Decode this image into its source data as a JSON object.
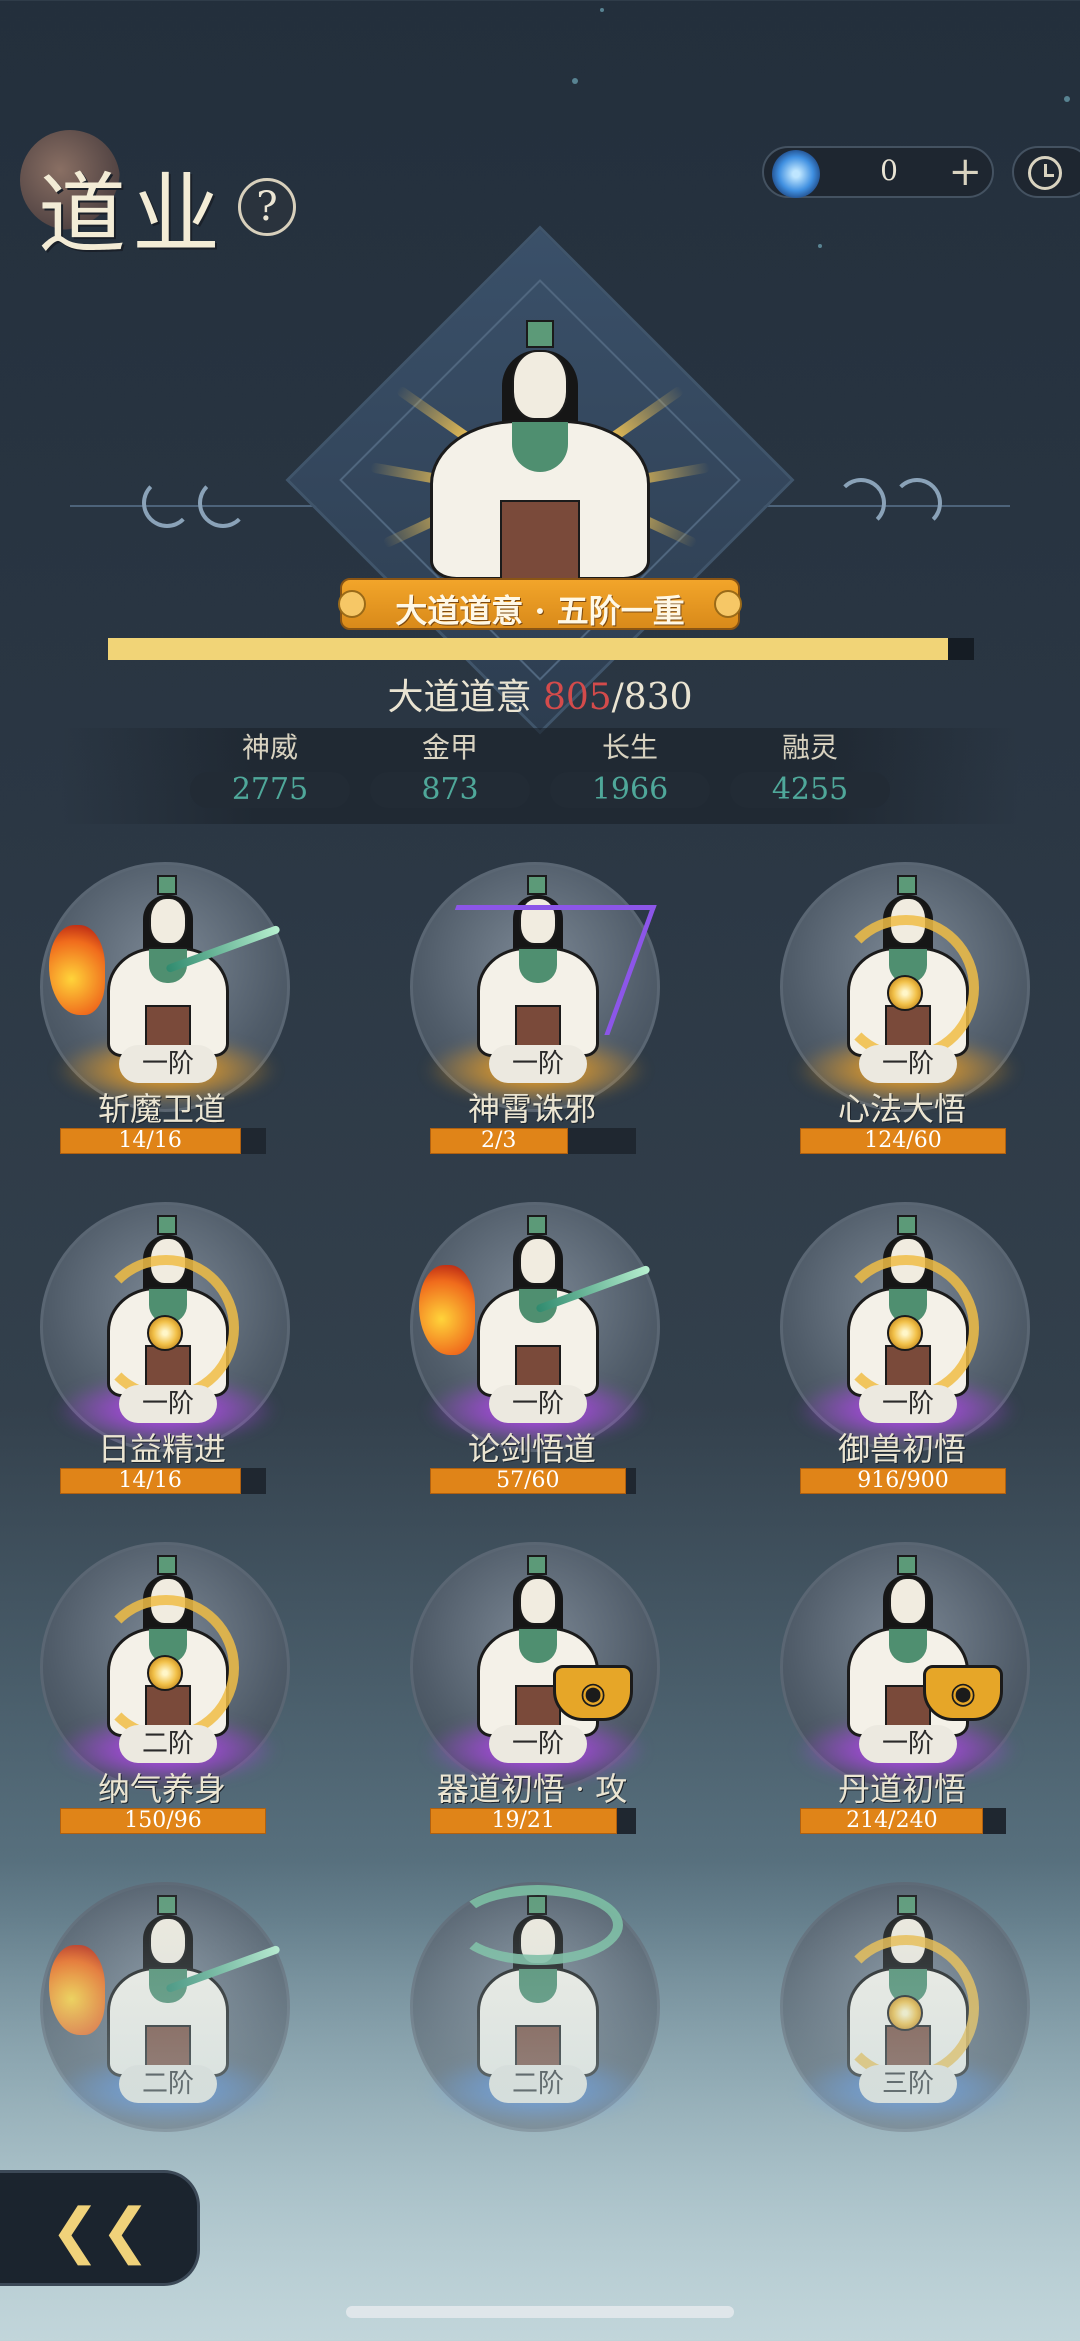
{
  "header": {
    "title": "道业",
    "help_label": "?",
    "currency_value": "0",
    "currency_plus": "+"
  },
  "hero": {
    "rank_label": "大道道意 · 五阶一重",
    "progress_label": "大道道意",
    "progress_current": "805",
    "progress_separator": "/",
    "progress_max": "830",
    "progress_fraction": 0.97
  },
  "stats": [
    {
      "label": "神威",
      "value": "2775"
    },
    {
      "label": "金甲",
      "value": "873"
    },
    {
      "label": "长生",
      "value": "1966"
    },
    {
      "label": "融灵",
      "value": "4255"
    }
  ],
  "skills": [
    {
      "name": "斩魔卫道",
      "tier": "一阶",
      "progress": "14/16",
      "fill": 0.875,
      "glow": "orange"
    },
    {
      "name": "神霄诛邪",
      "tier": "一阶",
      "progress": "2/3",
      "fill": 0.667,
      "glow": "orange"
    },
    {
      "name": "心法大悟",
      "tier": "一阶",
      "progress": "124/60",
      "fill": 1.0,
      "glow": "orange"
    },
    {
      "name": "日益精进",
      "tier": "一阶",
      "progress": "14/16",
      "fill": 0.875,
      "glow": "purple"
    },
    {
      "name": "论剑悟道",
      "tier": "一阶",
      "progress": "57/60",
      "fill": 0.95,
      "glow": "purple"
    },
    {
      "name": "御兽初悟",
      "tier": "一阶",
      "progress": "916/900",
      "fill": 1.0,
      "glow": "purple"
    },
    {
      "name": "纳气养身",
      "tier": "二阶",
      "progress": "150/96",
      "fill": 1.0,
      "glow": "purple"
    },
    {
      "name": "器道初悟 · 攻",
      "tier": "一阶",
      "progress": "19/21",
      "fill": 0.905,
      "glow": "purple"
    },
    {
      "name": "丹道初悟",
      "tier": "一阶",
      "progress": "214/240",
      "fill": 0.892,
      "glow": "purple"
    },
    {
      "name": "",
      "tier": "二阶",
      "progress": "",
      "fill": 0,
      "glow": "blue"
    },
    {
      "name": "",
      "tier": "二阶",
      "progress": "",
      "fill": 0,
      "glow": "blue"
    },
    {
      "name": "",
      "tier": "三阶",
      "progress": "",
      "fill": 0,
      "glow": "blue"
    }
  ],
  "icons": {
    "currency": "spirit-orb-icon",
    "history": "clock-icon",
    "back": "back-arrow-icon"
  },
  "colors": {
    "stat_value": "#4fa89a",
    "progress_current": "#d44b4b",
    "bar_fill": "#e08418",
    "banner": "#f2a52a"
  }
}
